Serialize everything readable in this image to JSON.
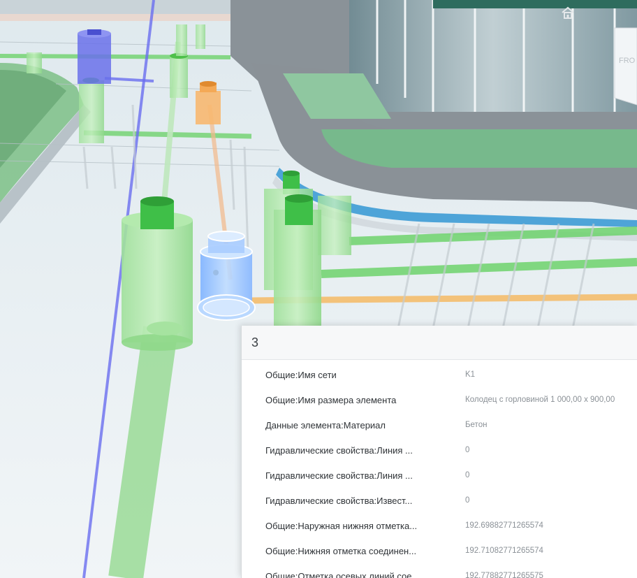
{
  "viewer": {
    "viewcube_label": "FRO"
  },
  "icons": {
    "home": "home-icon"
  },
  "properties_panel": {
    "title": "3",
    "rows": [
      {
        "name": "Общие:Имя сети",
        "value": "K1"
      },
      {
        "name": "Общие:Имя размера элемента",
        "value": "Колодец с горловиной 1 000,00 x 900,00"
      },
      {
        "name": "Данные элемента:Материал",
        "value": "Бетон"
      },
      {
        "name": "Гидравлические свойства:Линия ...",
        "value": "0"
      },
      {
        "name": "Гидравлические свойства:Линия ...",
        "value": "0"
      },
      {
        "name": "Гидравлические свойства:Извест...",
        "value": "0"
      },
      {
        "name": "Общие:Наружная нижняя отметка...",
        "value": "192.69882771265574"
      },
      {
        "name": "Общие:Нижняя отметка соединен...",
        "value": "192.71082771265574"
      },
      {
        "name": "Общие:Отметка осевых линий сое...",
        "value": "192.77882771265575"
      }
    ]
  }
}
